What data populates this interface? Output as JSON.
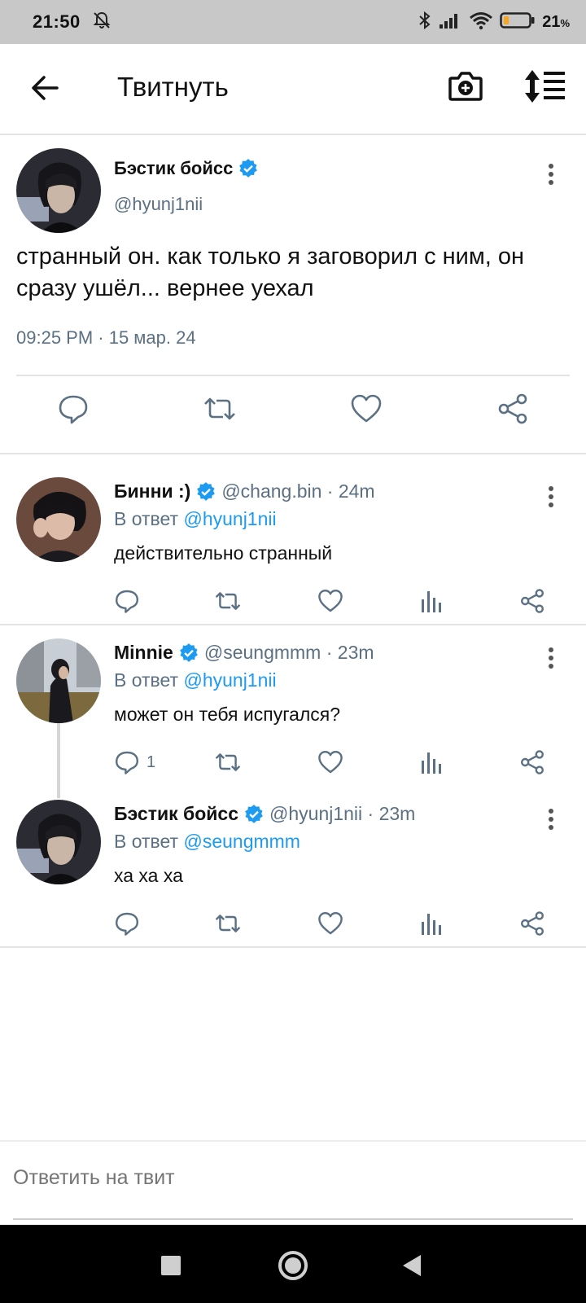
{
  "status_bar": {
    "time": "21:50",
    "battery_percent": "21",
    "battery_unit": "%",
    "battery_level": 0.21
  },
  "header": {
    "title": "Твитнуть"
  },
  "main_tweet": {
    "author_name": "Бэстик бойсс",
    "handle": "@hyunj1nii",
    "text": "странный он. как только я заговорил с ним, он сразу ушёл... вернее уехал",
    "timestamp": "09:25 PM · 15 мар. 24"
  },
  "replies": [
    {
      "author_name": "Бинни :)",
      "handle_time": "@chang.bin · 24m",
      "reply_prefix": "В ответ",
      "reply_to": "@hyunj1nii",
      "text": "действительно странный",
      "reply_count": ""
    },
    {
      "author_name": "Minnie",
      "handle_time": "@seungmmm · 23m",
      "reply_prefix": "В ответ",
      "reply_to": "@hyunj1nii",
      "text": "может он тебя испугался?",
      "reply_count": "1"
    },
    {
      "author_name": "Бэстик бойсс",
      "handle_time": "@hyunj1nii · 23m",
      "reply_prefix": "В ответ",
      "reply_to": "@seungmmm",
      "text": "ха ха ха",
      "reply_count": ""
    }
  ],
  "composer": {
    "placeholder": "Ответить на твит"
  },
  "colors": {
    "accent": "#1d9bf0",
    "secondary_text": "#5b7083",
    "verified": "#1d9bf0",
    "status_bar_bg": "#c8c8c8",
    "battery_fill": "#f5a623"
  }
}
